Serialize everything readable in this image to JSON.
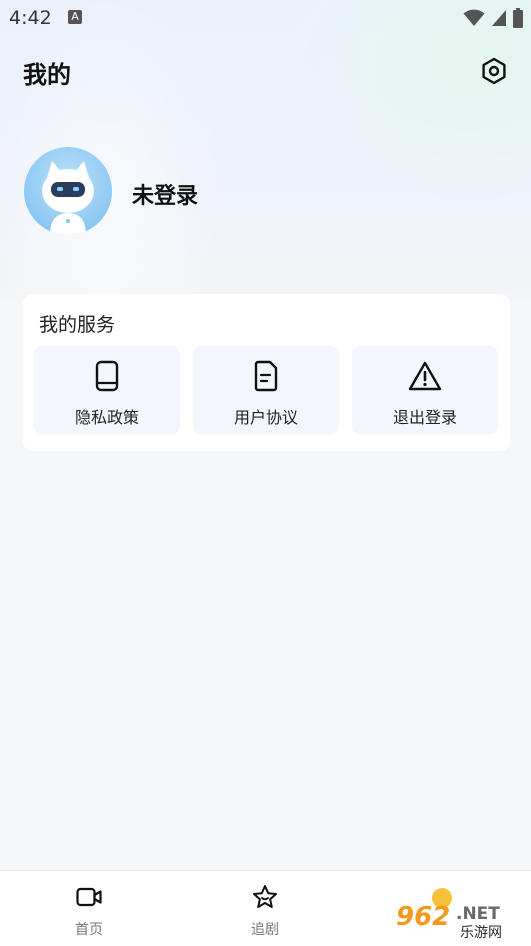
{
  "status_bar": {
    "time": "4:42",
    "indicator": "A"
  },
  "header": {
    "title": "我的",
    "settings_icon": "settings-hexagon-icon"
  },
  "profile": {
    "login_status": "未登录",
    "avatar_icon": "robot-cat-avatar"
  },
  "services": {
    "title": "我的服务",
    "items": [
      {
        "label": "隐私政策",
        "icon": "phone-icon"
      },
      {
        "label": "用户协议",
        "icon": "document-icon"
      },
      {
        "label": "退出登录",
        "icon": "warning-icon"
      }
    ]
  },
  "bottom_nav": {
    "items": [
      {
        "label": "首页",
        "icon": "video-icon"
      },
      {
        "label": "追剧",
        "icon": "star-icon"
      }
    ]
  },
  "watermark": {
    "text": "962.NET",
    "subtext": "乐游网"
  }
}
